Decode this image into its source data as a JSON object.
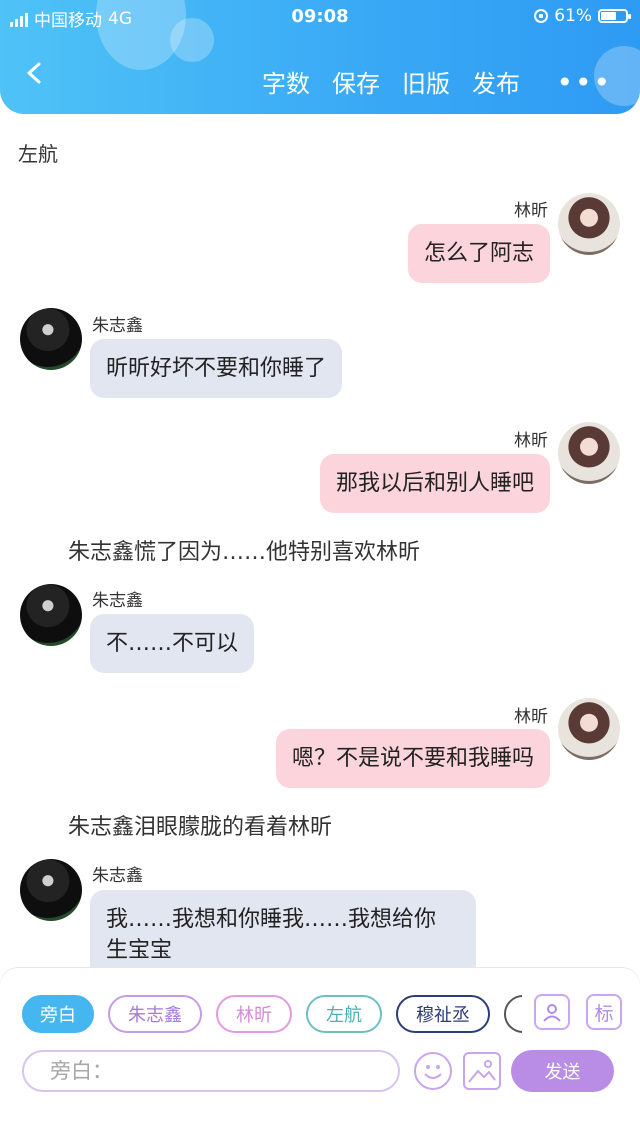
{
  "status_bar": {
    "carrier": "中国移动",
    "network": "4G",
    "time": "09:08",
    "battery_percent": "61%",
    "battery_level": 0.61
  },
  "header": {
    "nav": [
      "字数",
      "保存",
      "旧版",
      "发布"
    ],
    "more": "•••"
  },
  "chat": {
    "narration_top": "左航",
    "messages": [
      {
        "side": "right",
        "name": "林昕",
        "text": "怎么了阿志"
      },
      {
        "side": "left",
        "name": "朱志鑫",
        "text": "昕昕好坏不要和你睡了"
      },
      {
        "side": "right",
        "name": "林昕",
        "text": "那我以后和别人睡吧"
      },
      {
        "narration": "朱志鑫慌了因为……他特别喜欢林昕"
      },
      {
        "side": "left",
        "name": "朱志鑫",
        "text": "不……不可以"
      },
      {
        "side": "right",
        "name": "林昕",
        "text": "嗯？不是说不要和我睡吗"
      },
      {
        "narration": "朱志鑫泪眼朦胧的看着林昕"
      },
      {
        "side": "left",
        "name": "朱志鑫",
        "text": "我……我想和你睡我……我想给你\n生宝宝"
      }
    ]
  },
  "composer": {
    "roles": [
      {
        "label": "旁白",
        "color": "#45b6f0",
        "active": true
      },
      {
        "label": "朱志鑫",
        "color": "#c79be8"
      },
      {
        "label": "林昕",
        "color": "#e29ae0"
      },
      {
        "label": "左航",
        "color": "#6cc0c0"
      },
      {
        "label": "穆祉丞",
        "color": "#2d3d7a"
      }
    ],
    "role_button_icon": "person-card-icon",
    "tag_button": "标",
    "placeholder": "旁白：",
    "emoji_icon": "smiley-icon",
    "image_icon": "image-icon",
    "send": "发送"
  },
  "colors": {
    "header_blue": "#3aa8f5",
    "bubble_right": "#fbd5db",
    "bubble_left": "#e2e6f1",
    "accent_purple": "#b98de6"
  }
}
